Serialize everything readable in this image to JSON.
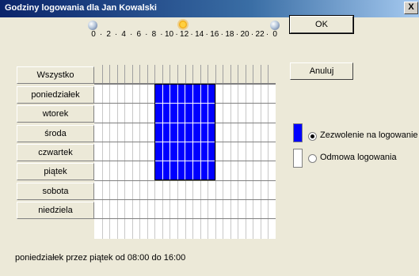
{
  "window": {
    "title": "Godziny logowania dla Jan Kowalski",
    "close_label": "X"
  },
  "icons": [
    "moon-icon",
    "sun-icon",
    "moon-icon"
  ],
  "hour_scale": [
    "0",
    "2",
    "4",
    "6",
    "8",
    "10",
    "12",
    "14",
    "16",
    "18",
    "20",
    "22",
    "0"
  ],
  "hour_separator": "·",
  "all_label": "Wszystko",
  "days": [
    "poniedziałek",
    "wtorek",
    "środa",
    "czwartek",
    "piątek",
    "sobota",
    "niedziela"
  ],
  "selection": {
    "from_day": "poniedziałek",
    "to_day": "piątek",
    "from_hour": 8,
    "to_hour": 16,
    "color": "#0000ff"
  },
  "buttons": {
    "ok": "OK",
    "cancel": "Anuluj"
  },
  "legend": [
    {
      "label": "Zezwolenie na logowanie",
      "color": "#0000ff",
      "checked": true
    },
    {
      "label": "Odmowa logowania",
      "color": "#ffffff",
      "checked": false
    }
  ],
  "summary": "poniedziałek przez piątek od 08:00 do 16:00"
}
